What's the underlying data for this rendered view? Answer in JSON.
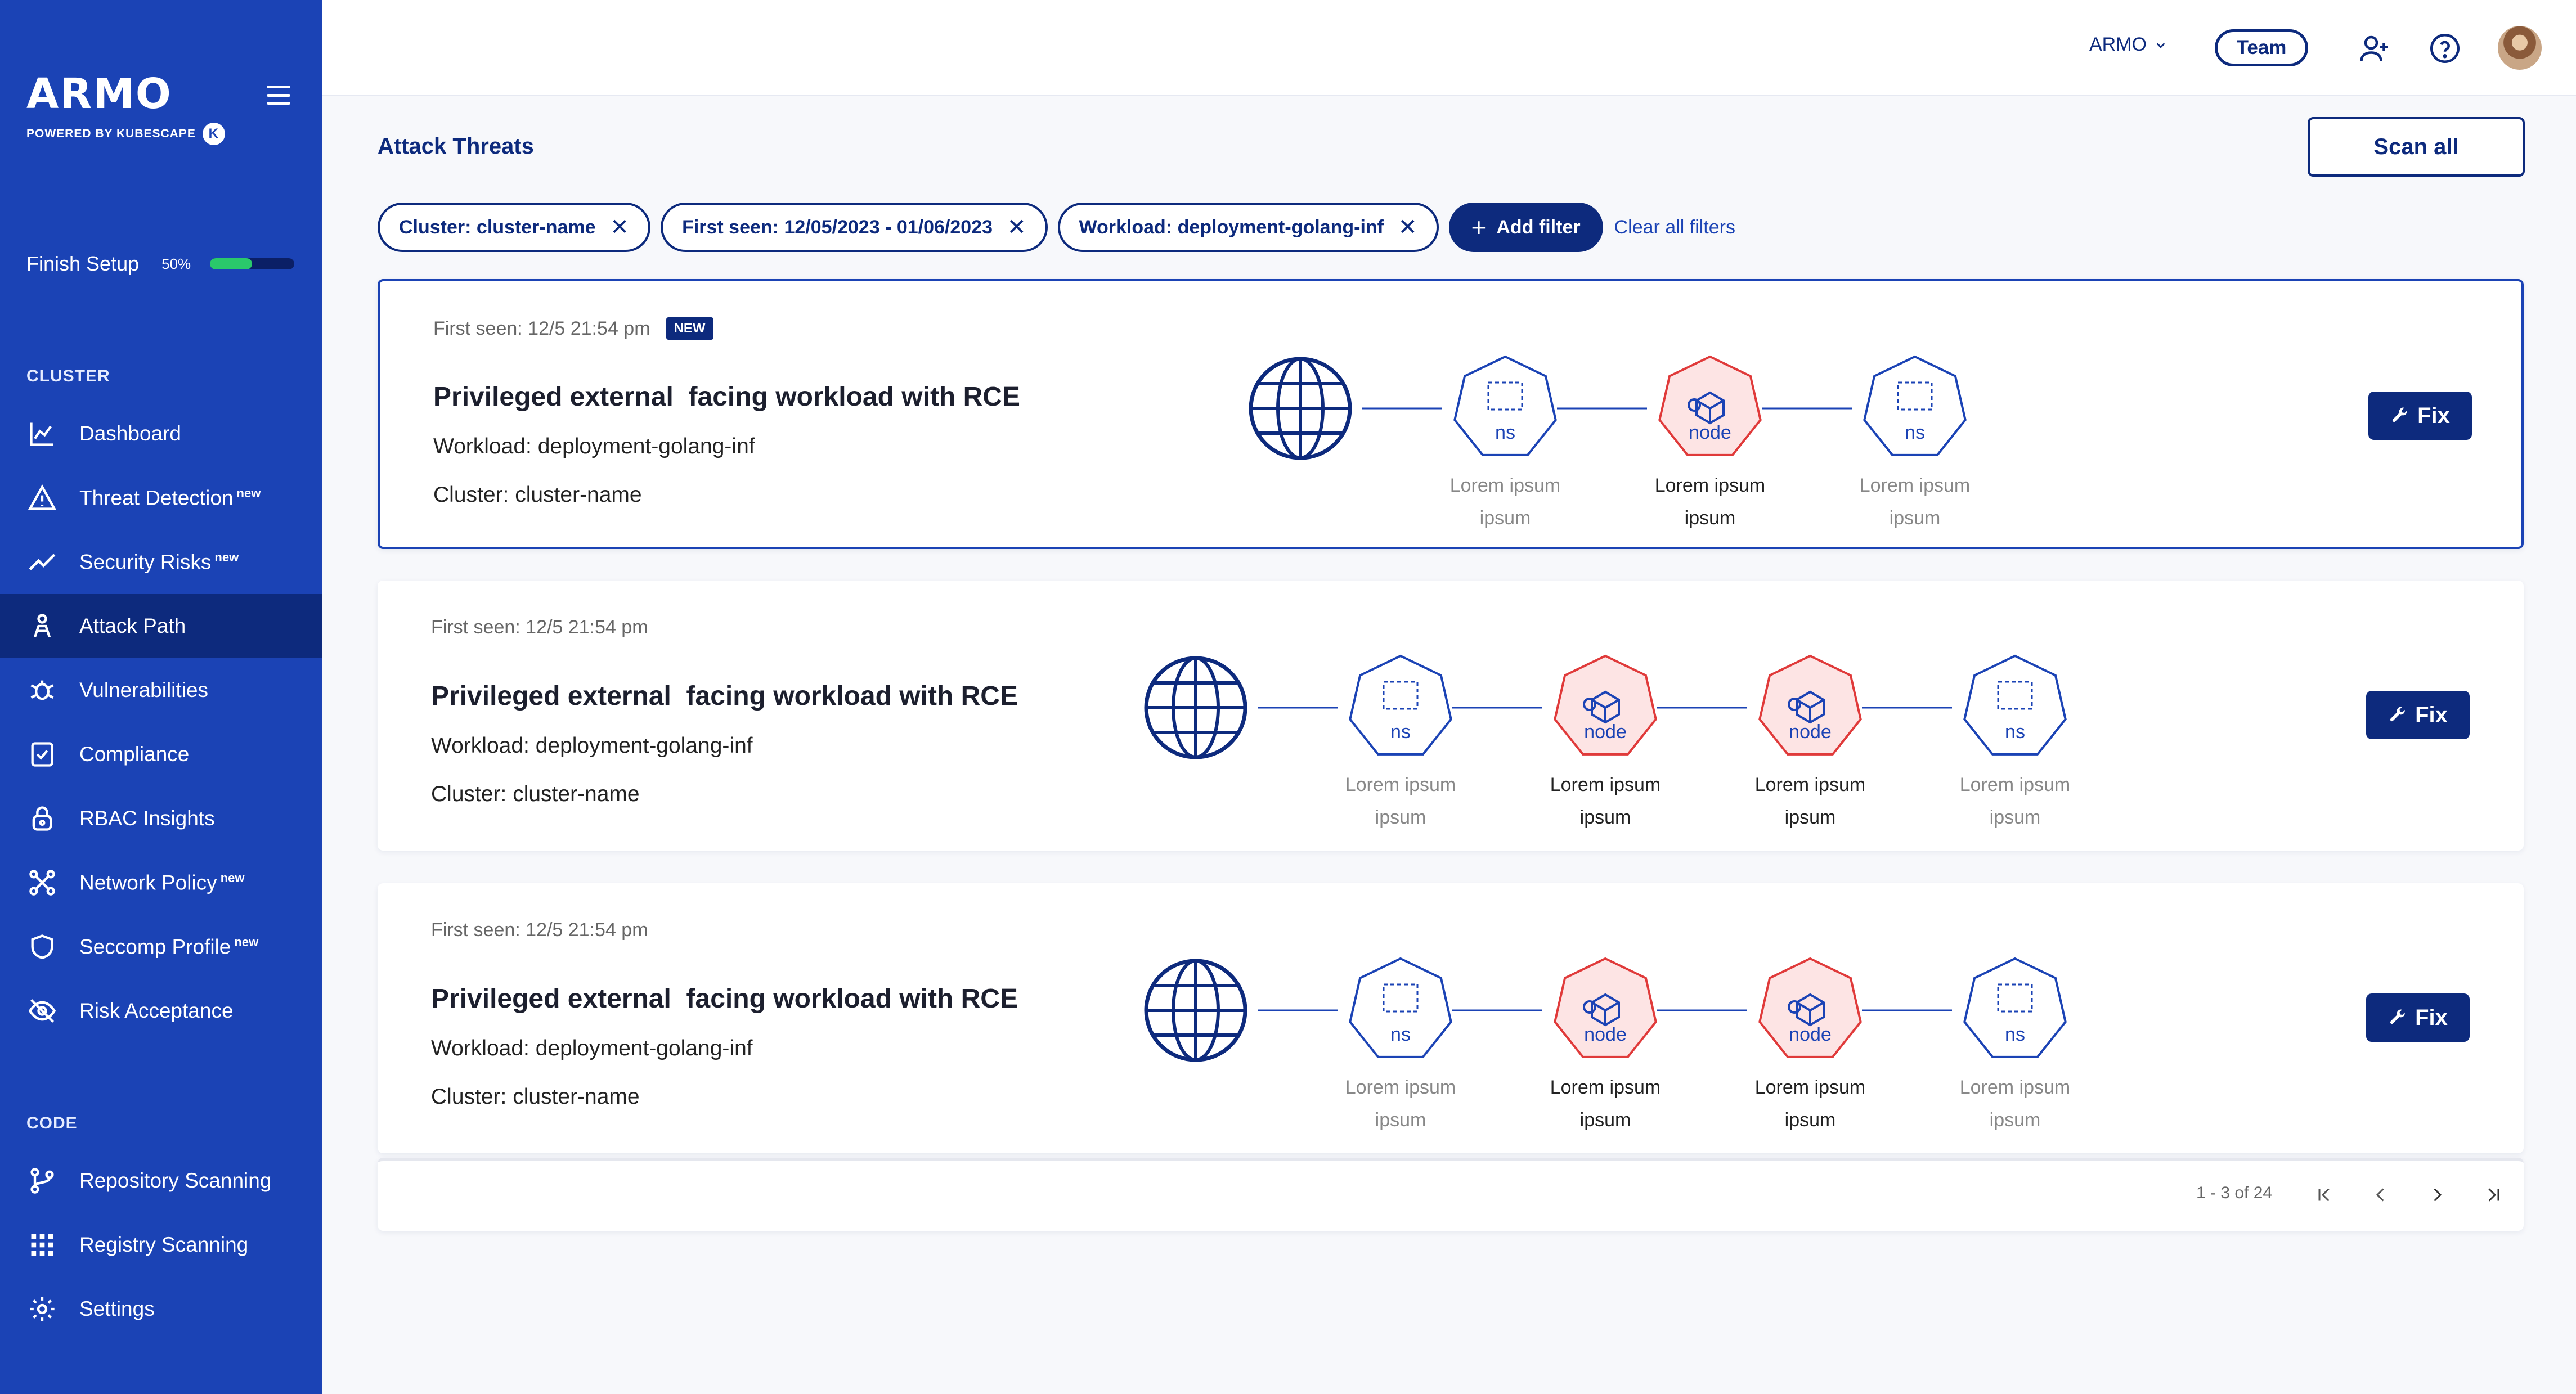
{
  "brand": {
    "name": "ARMO",
    "tagline": "POWERED BY KUBESCAPE",
    "badge": "K"
  },
  "setup": {
    "label": "Finish Setup",
    "percent_label": "50%",
    "progress": 0.5
  },
  "sections": {
    "cluster": "CLUSTER",
    "code": "CODE"
  },
  "nav": {
    "dashboard": {
      "label": "Dashboard",
      "icon": "chart-icon"
    },
    "threat_detection": {
      "label": "Threat Detection",
      "badge": "new",
      "icon": "warning-icon"
    },
    "security_risks": {
      "label": "Security Risks",
      "badge": "new",
      "icon": "trend-icon"
    },
    "attack_path": {
      "label": "Attack Path",
      "icon": "attack-path-icon"
    },
    "vulnerabilities": {
      "label": "Vulnerabilities",
      "icon": "bug-icon"
    },
    "compliance": {
      "label": "Compliance",
      "icon": "checklist-icon"
    },
    "rbac": {
      "label": "RBAC Insights",
      "icon": "lock-icon"
    },
    "network_policy": {
      "label": "Network Policy",
      "badge": "new",
      "icon": "network-icon"
    },
    "seccomp": {
      "label": "Seccomp Profile",
      "badge": "new",
      "icon": "shield-icon"
    },
    "risk_acceptance": {
      "label": "Risk Acceptance",
      "icon": "eye-off-icon"
    },
    "repo_scanning": {
      "label": "Repository Scanning",
      "icon": "git-branch-icon"
    },
    "registry_scanning": {
      "label": "Registry Scanning",
      "icon": "grid-icon"
    },
    "settings": {
      "label": "Settings",
      "icon": "gear-icon"
    }
  },
  "topbar": {
    "org": "ARMO",
    "team": "Team"
  },
  "page": {
    "title": "Attack Threats",
    "scan_all": "Scan all"
  },
  "filters": {
    "cluster": "Cluster: cluster-name",
    "first_seen": "First seen: 12/05/2023 - 01/06/2023",
    "workload": "Workload: deployment-golang-inf",
    "add": "Add filter",
    "clear": "Clear all filters"
  },
  "threats": [
    {
      "first_seen": "First seen: 12/5   21:54 pm",
      "badge": "NEW",
      "title": "Privileged external  facing workload with RCE",
      "workload": "Workload: deployment-golang-inf",
      "cluster": "Cluster: cluster-name",
      "fix": "Fix",
      "nodes": [
        {
          "kind": "ns",
          "label": "ns",
          "desc1": "Lorem ipsum",
          "desc2": "ipsum"
        },
        {
          "kind": "node",
          "label": "node",
          "desc1": "Lorem ipsum",
          "desc2": "ipsum"
        },
        {
          "kind": "ns",
          "label": "ns",
          "desc1": "Lorem ipsum",
          "desc2": "ipsum"
        }
      ]
    },
    {
      "first_seen": "First seen: 12/5   21:54 pm",
      "title": "Privileged external  facing workload with RCE",
      "workload": "Workload: deployment-golang-inf",
      "cluster": "Cluster: cluster-name",
      "fix": "Fix",
      "nodes": [
        {
          "kind": "ns",
          "label": "ns",
          "desc1": "Lorem ipsum",
          "desc2": "ipsum"
        },
        {
          "kind": "node",
          "label": "node",
          "desc1": "Lorem ipsum",
          "desc2": "ipsum"
        },
        {
          "kind": "node",
          "label": "node",
          "desc1": "Lorem ipsum",
          "desc2": "ipsum"
        },
        {
          "kind": "ns",
          "label": "ns",
          "desc1": "Lorem ipsum",
          "desc2": "ipsum"
        }
      ]
    },
    {
      "first_seen": "First seen: 12/5   21:54 pm",
      "title": "Privileged external  facing workload with RCE",
      "workload": "Workload: deployment-golang-inf",
      "cluster": "Cluster: cluster-name",
      "fix": "Fix",
      "nodes": [
        {
          "kind": "ns",
          "label": "ns",
          "desc1": "Lorem ipsum",
          "desc2": "ipsum"
        },
        {
          "kind": "node",
          "label": "node",
          "desc1": "Lorem ipsum",
          "desc2": "ipsum"
        },
        {
          "kind": "node",
          "label": "node",
          "desc1": "Lorem ipsum",
          "desc2": "ipsum"
        },
        {
          "kind": "ns",
          "label": "ns",
          "desc1": "Lorem ipsum",
          "desc2": "ipsum"
        }
      ]
    }
  ],
  "pagination": {
    "text": "1 - 3 of 24"
  },
  "colors": {
    "brand": "#1b43b5",
    "navy": "#0d2a7d",
    "risk": "#e03a3a",
    "risk_fill": "#fde4e4",
    "progress": "#2ac96b"
  }
}
